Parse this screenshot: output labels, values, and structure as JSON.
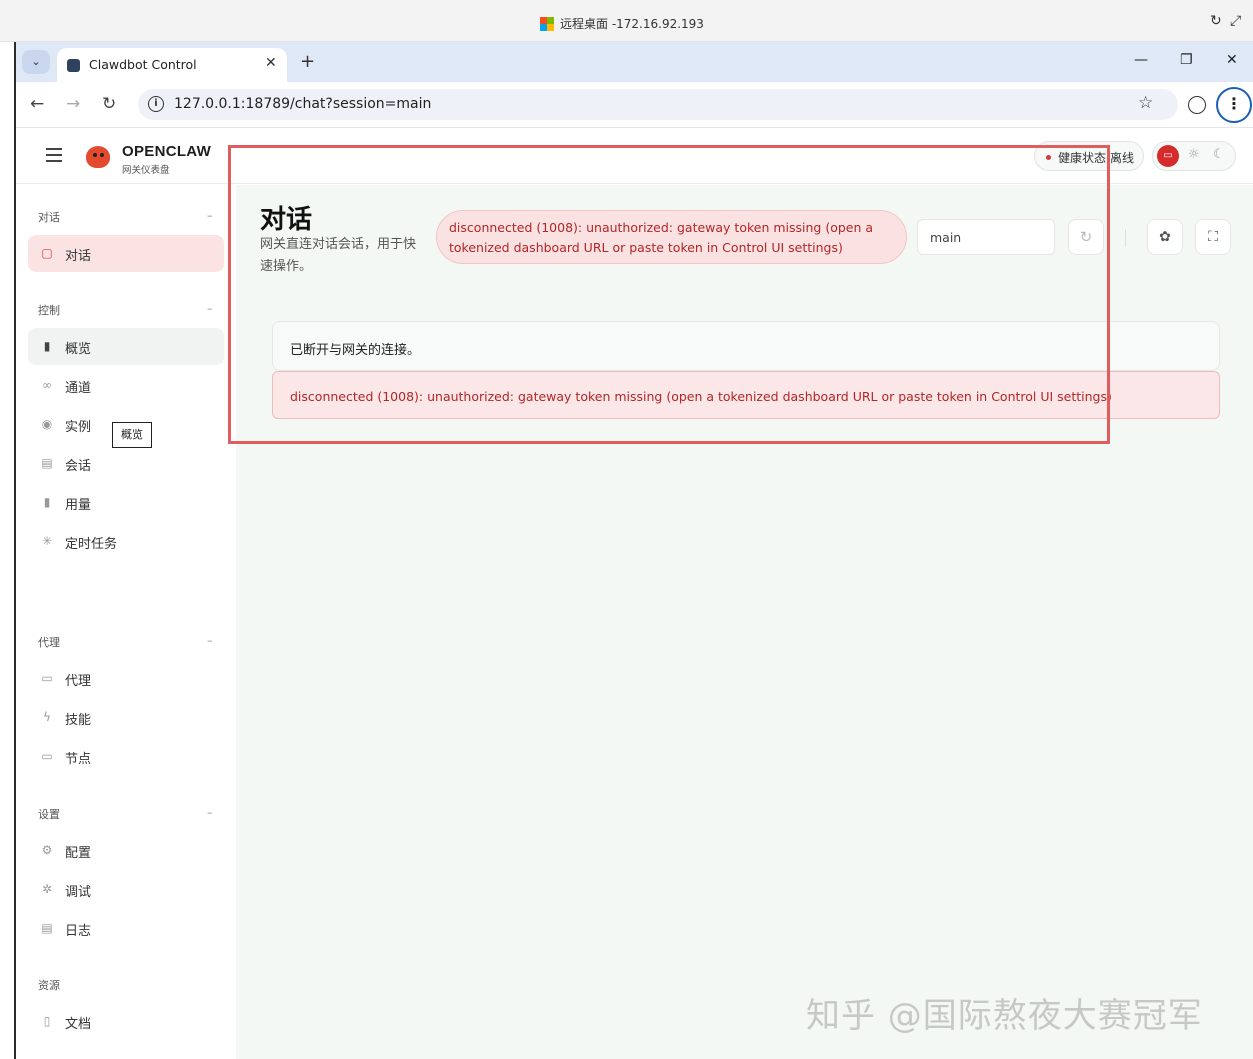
{
  "remote_desktop": {
    "title": "远程桌面 -172.16.92.193"
  },
  "browser": {
    "tab_title": "Clawdbot Control",
    "url": "127.0.0.1:18789/chat?session=main"
  },
  "header": {
    "brand": "OPENCLAW",
    "brand_sub": "网关仪表盘",
    "health_label": "健康状态",
    "health_value": "离线"
  },
  "sidebar": {
    "sections": [
      {
        "title": "对话",
        "items": [
          {
            "label": "对话",
            "icon": "chat-icon"
          }
        ]
      },
      {
        "title": "控制",
        "items": [
          {
            "label": "概览",
            "icon": "bar-chart-icon"
          },
          {
            "label": "通道",
            "icon": "link-icon"
          },
          {
            "label": "实例",
            "icon": "broadcast-icon"
          },
          {
            "label": "会话",
            "icon": "document-icon"
          },
          {
            "label": "用量",
            "icon": "usage-chart-icon"
          },
          {
            "label": "定时任务",
            "icon": "loader-icon"
          }
        ]
      },
      {
        "title": "代理",
        "items": [
          {
            "label": "代理",
            "icon": "folder-icon"
          },
          {
            "label": "技能",
            "icon": "lightning-icon"
          },
          {
            "label": "节点",
            "icon": "monitor-icon"
          }
        ]
      },
      {
        "title": "设置",
        "items": [
          {
            "label": "配置",
            "icon": "gear-icon"
          },
          {
            "label": "调试",
            "icon": "bug-icon"
          },
          {
            "label": "日志",
            "icon": "scroll-icon"
          }
        ]
      },
      {
        "title": "资源",
        "items": [
          {
            "label": "文档",
            "icon": "book-icon"
          }
        ]
      }
    ],
    "tooltip": "概览"
  },
  "main": {
    "title": "对话",
    "subtitle": "网关直连对话会话，用于快速操作。",
    "error_pill": "disconnected (1008): unauthorized: gateway token missing (open a tokenized dashboard URL or paste token in Control UI settings)",
    "session_value": "main",
    "chat_message": "已断开与网关的连接。",
    "error_banner": "disconnected (1008): unauthorized: gateway token missing (open a tokenized dashboard URL or paste token in Control UI settings)"
  },
  "watermark": "知乎 @国际熬夜大赛冠军",
  "colors": {
    "accent": "#d13b3b",
    "error_text": "#b32626",
    "highlight_border": "#e05d5d"
  }
}
